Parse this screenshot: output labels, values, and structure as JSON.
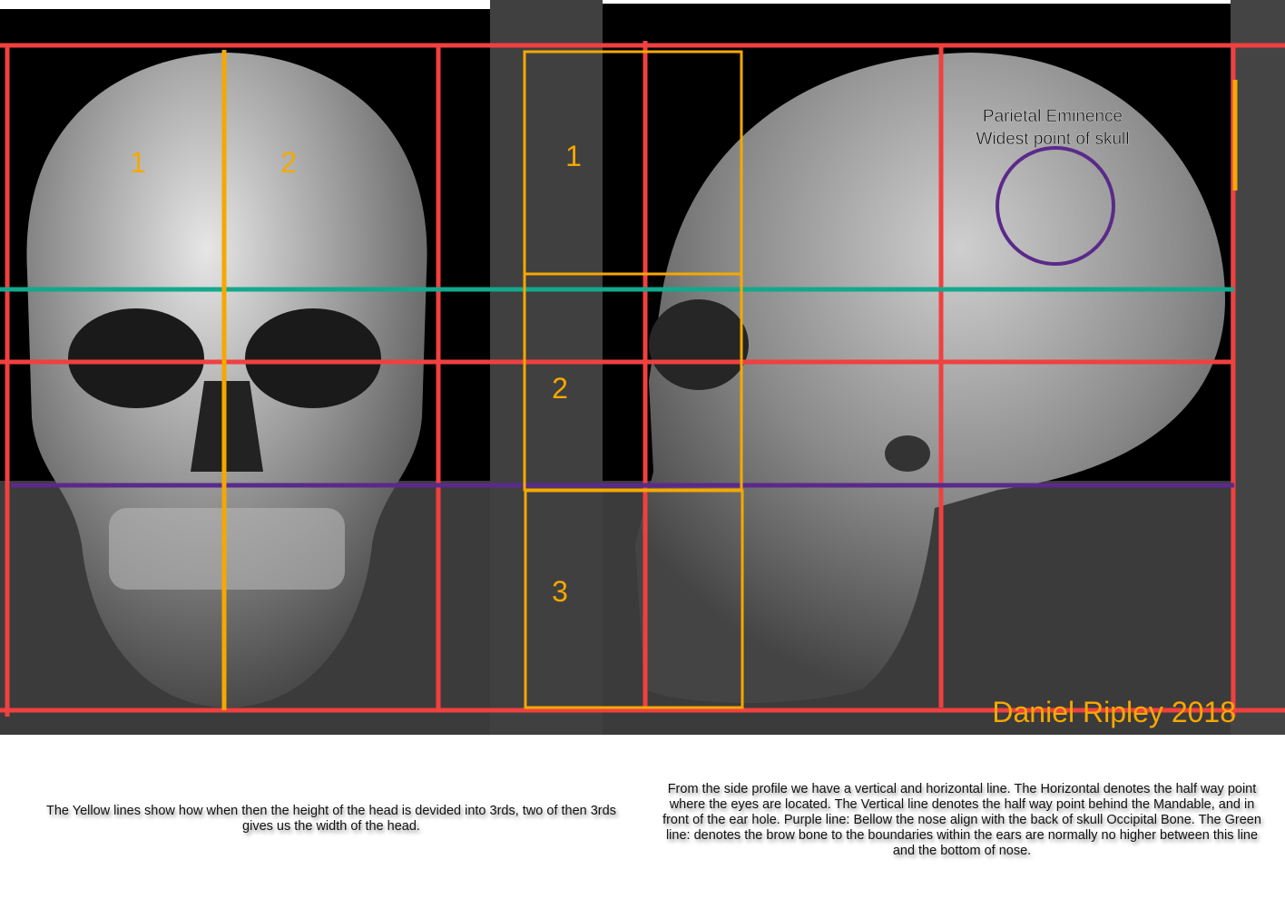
{
  "front_view": {
    "labels": [
      "1",
      "2"
    ]
  },
  "thirds_column": {
    "labels": [
      "1",
      "2",
      "3"
    ]
  },
  "side_view": {
    "annotation_line1": "Parietal Eminence",
    "annotation_line2": "Widest point of skull"
  },
  "signature": "Daniel Ripley 2018",
  "captions": {
    "left": "The Yellow lines show how when then the height of the head is devided into 3rds, two of then 3rds gives us the width of the head.",
    "right": "From the side profile we have a vertical and horizontal line.  The Horizontal  denotes the half way point where the eyes are located. The Vertical  line denotes the half way point behind the Mandable, and in front of the ear hole.  Purple line: Bellow the nose align with the back of skull Occipital Bone. The Green line: denotes the brow bone to the boundaries within the ears are normally no higher between this line and the bottom of nose."
  },
  "colors": {
    "red": "#f04040",
    "yellow": "#f5a800",
    "green": "#14a88c",
    "purple": "#5a2a8a"
  }
}
